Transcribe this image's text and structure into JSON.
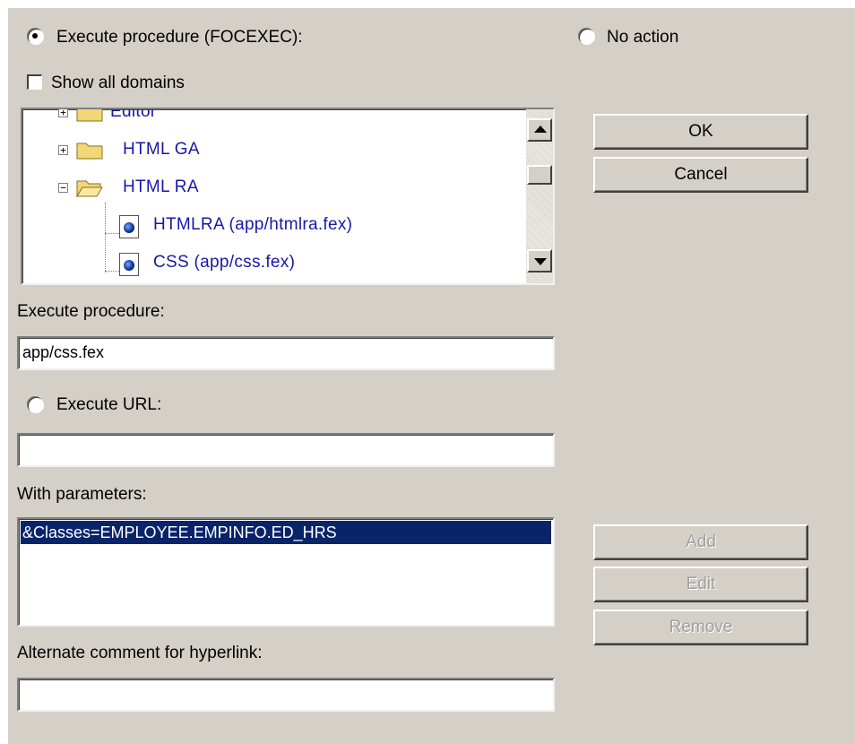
{
  "radios": {
    "execute_procedure": {
      "label": "Execute procedure (FOCEXEC):",
      "checked": true
    },
    "no_action": {
      "label": "No action",
      "checked": false
    },
    "execute_url": {
      "label": "Execute URL:",
      "checked": false
    }
  },
  "show_all_domains": {
    "label": "Show all domains",
    "checked": false
  },
  "tree": {
    "items": [
      {
        "label": "Editor",
        "type": "folder",
        "expander": "+"
      },
      {
        "label": "HTML GA",
        "type": "folder",
        "expander": "+"
      },
      {
        "label": "HTML RA",
        "type": "folder-open",
        "expander": "−"
      },
      {
        "label": "HTMLRA (app/htmlra.fex)",
        "type": "procedure"
      },
      {
        "label": "CSS (app/css.fex)",
        "type": "procedure"
      }
    ]
  },
  "execute_procedure": {
    "label": "Execute procedure:",
    "value": "app/css.fex"
  },
  "execute_url": {
    "value": ""
  },
  "parameters": {
    "label": "With parameters:",
    "items": [
      "&Classes=EMPLOYEE.EMPINFO.ED_HRS"
    ],
    "selected_index": 0
  },
  "alternate_comment": {
    "label": "Alternate comment for hyperlink:",
    "value": ""
  },
  "buttons": {
    "ok": "OK",
    "cancel": "Cancel",
    "add": "Add",
    "edit": "Edit",
    "remove": "Remove"
  },
  "colors": {
    "dialog_bg": "#d4d0c8",
    "tree_text": "#1818a8",
    "selection": "#0a246a"
  },
  "icons": [
    "radio-button-icon",
    "checkbox-icon",
    "folder-icon",
    "folder-open-icon",
    "procedure-icon",
    "scroll-up-arrow-icon",
    "scroll-down-arrow-icon"
  ]
}
